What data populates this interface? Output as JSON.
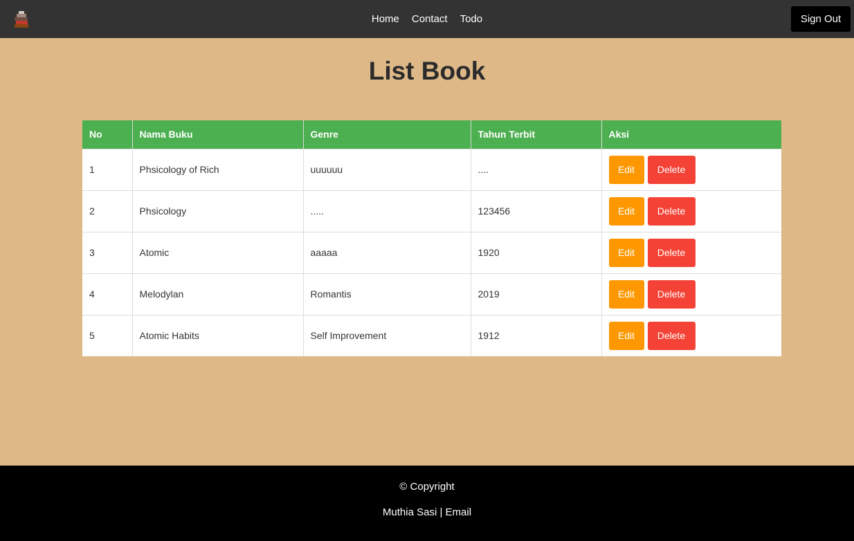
{
  "navbar": {
    "logo_icon": "book-stack-icon",
    "links": [
      {
        "label": "Home"
      },
      {
        "label": "Contact"
      },
      {
        "label": "Todo"
      }
    ],
    "signout_label": "Sign Out"
  },
  "page": {
    "title": "List Book"
  },
  "table": {
    "headers": [
      "No",
      "Nama Buku",
      "Genre",
      "Tahun Terbit",
      "Aksi"
    ],
    "rows": [
      {
        "no": "1",
        "nama": "Phsicology of Rich",
        "genre": "uuuuuu",
        "tahun": "....",
        "edit": "Edit",
        "delete": "Delete"
      },
      {
        "no": "2",
        "nama": "Phsicology",
        "genre": ".....",
        "tahun": "123456",
        "edit": "Edit",
        "delete": "Delete"
      },
      {
        "no": "3",
        "nama": "Atomic",
        "genre": "aaaaa",
        "tahun": "1920",
        "edit": "Edit",
        "delete": "Delete"
      },
      {
        "no": "4",
        "nama": "Melodylan",
        "genre": "Romantis",
        "tahun": "2019",
        "edit": "Edit",
        "delete": "Delete"
      },
      {
        "no": "5",
        "nama": "Atomic Habits",
        "genre": "Self Improvement",
        "tahun": "1912",
        "edit": "Edit",
        "delete": "Delete"
      }
    ]
  },
  "footer": {
    "copyright": "© Copyright",
    "name": "Muthia Sasi",
    "separator": "|",
    "email_label": "Email"
  },
  "colors": {
    "navbar": "#333333",
    "background": "#deb887",
    "table_header": "#4caf50",
    "edit": "#ff9800",
    "delete": "#f44336",
    "footer": "#000000"
  }
}
